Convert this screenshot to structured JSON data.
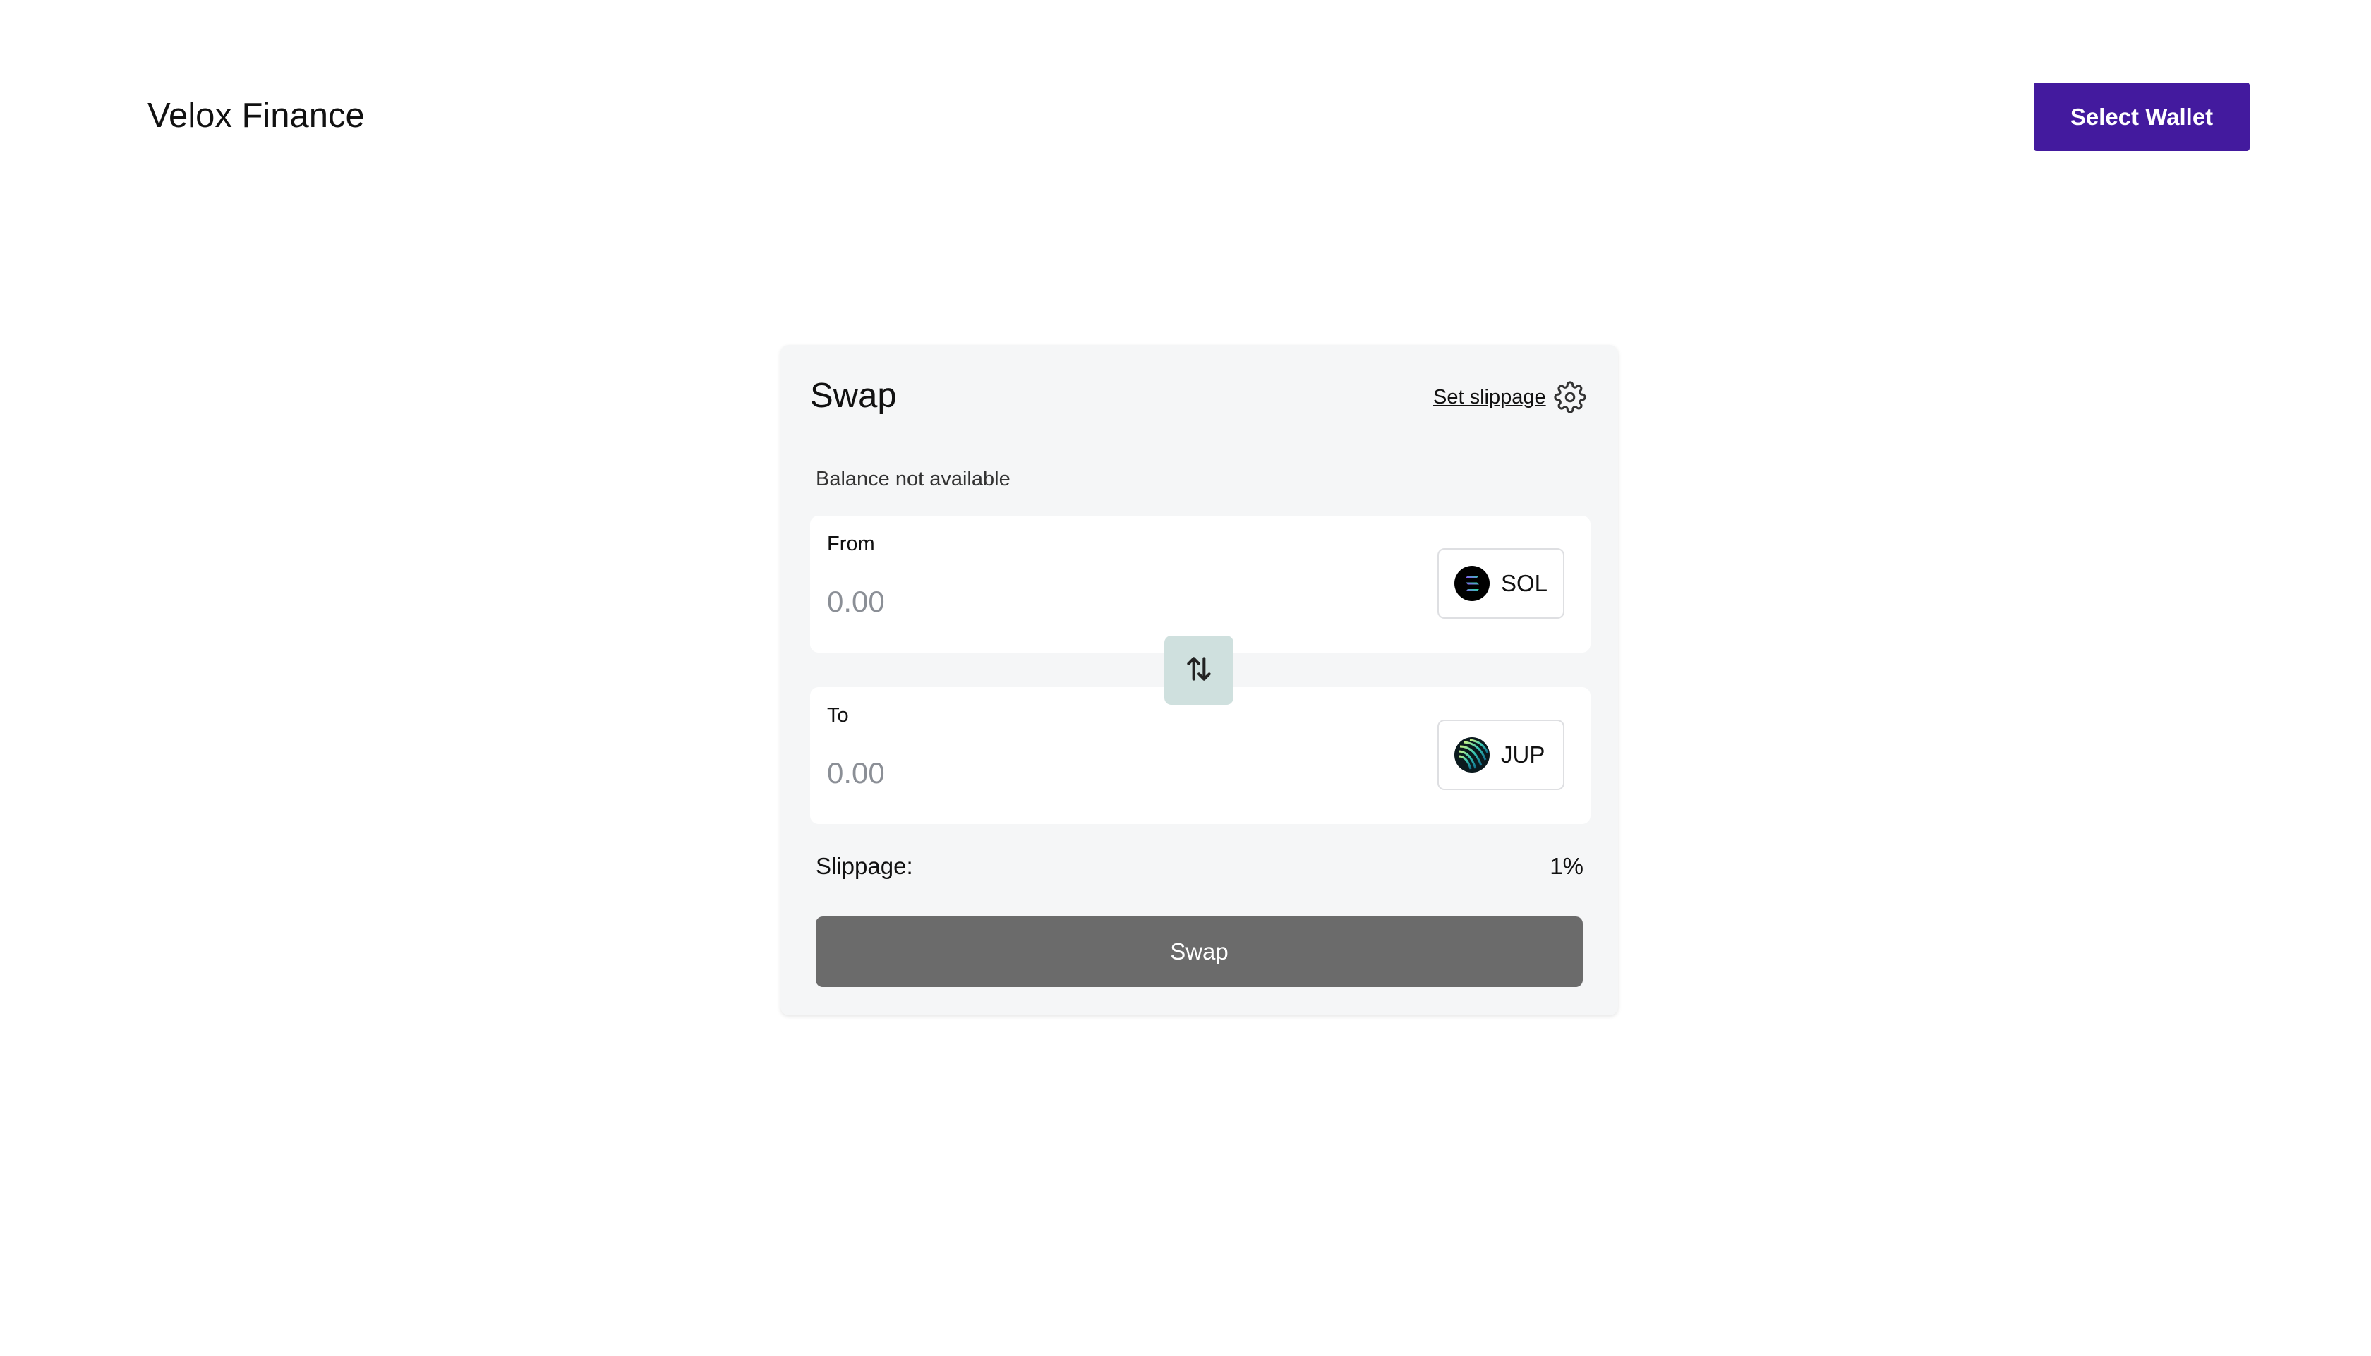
{
  "header": {
    "brand": "Velox Finance",
    "wallet_button": "Select Wallet"
  },
  "swap_card": {
    "title": "Swap",
    "slippage_link": "Set slippage",
    "balance_text": "Balance not available",
    "from": {
      "label": "From",
      "placeholder": "0.00",
      "token": "SOL",
      "token_icon": "solana-icon"
    },
    "to": {
      "label": "To",
      "placeholder": "0.00",
      "token": "JUP",
      "token_icon": "jupiter-icon"
    },
    "switch_icon": "swap-arrows-icon",
    "slippage_label": "Slippage:",
    "slippage_value": "1%",
    "swap_button": "Swap"
  },
  "colors": {
    "accent": "#431a9e",
    "card_background": "#f5f6f7",
    "switch_background": "#cfe0de",
    "swap_button_disabled": "#6b6b6b"
  }
}
